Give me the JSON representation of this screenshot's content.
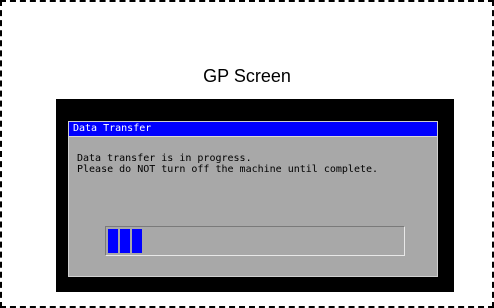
{
  "figure": {
    "caption": "GP Screen"
  },
  "dialog": {
    "title": "Data Transfer",
    "message_line1": "Data transfer is in progress.",
    "message_line2": "Please do NOT turn off the machine until complete."
  },
  "progress": {
    "filled_blocks": 3,
    "fraction": 0.12,
    "color": "#0000ff"
  },
  "colors": {
    "screen_background": "#000000",
    "dialog_background": "#a8a8a8",
    "titlebar": "#0000ff"
  }
}
